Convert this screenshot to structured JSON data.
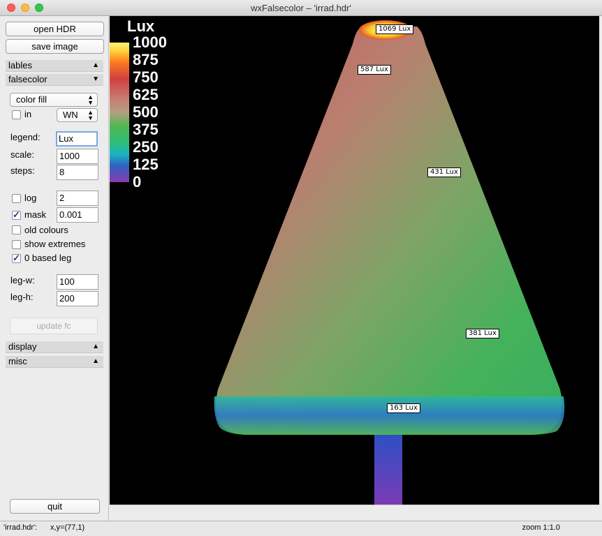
{
  "window": {
    "title": "wxFalsecolor – 'irrad.hdr'"
  },
  "sidebar": {
    "open_button": "open HDR",
    "save_button": "save image",
    "section_lables": "lables",
    "section_falsecolor": "falsecolor",
    "section_display": "display",
    "section_misc": "misc",
    "mode_select": "color fill",
    "in_label": "in",
    "in_checked": false,
    "unit_select": "WN",
    "legend_label": "legend:",
    "legend_value": "Lux",
    "scale_label": "scale:",
    "scale_value": "1000",
    "steps_label": "steps:",
    "steps_value": "8",
    "log_label": "log",
    "log_checked": false,
    "log_value": "2",
    "mask_label": "mask",
    "mask_checked": true,
    "mask_value": "0.001",
    "old_colours_label": "old colours",
    "old_colours_checked": false,
    "show_extremes_label": "show extremes",
    "show_extremes_checked": false,
    "zero_based_label": "0 based leg",
    "zero_based_checked": true,
    "legw_label": "leg-w:",
    "legw_value": "100",
    "legh_label": "leg-h:",
    "legh_value": "200",
    "update_button": "update fc",
    "quit_button": "quit"
  },
  "viewer": {
    "legend_title": "Lux",
    "legend_ticks": [
      "1000",
      "875",
      "750",
      "625",
      "500",
      "375",
      "250",
      "125",
      "0"
    ],
    "labels": [
      "1069 Lux",
      "587 Lux",
      "431 Lux",
      "381 Lux",
      "163 Lux"
    ]
  },
  "status": {
    "filename": "'irrad.hdr':",
    "coords": "x,y=(77,1)",
    "zoom": "zoom 1:1.0"
  }
}
